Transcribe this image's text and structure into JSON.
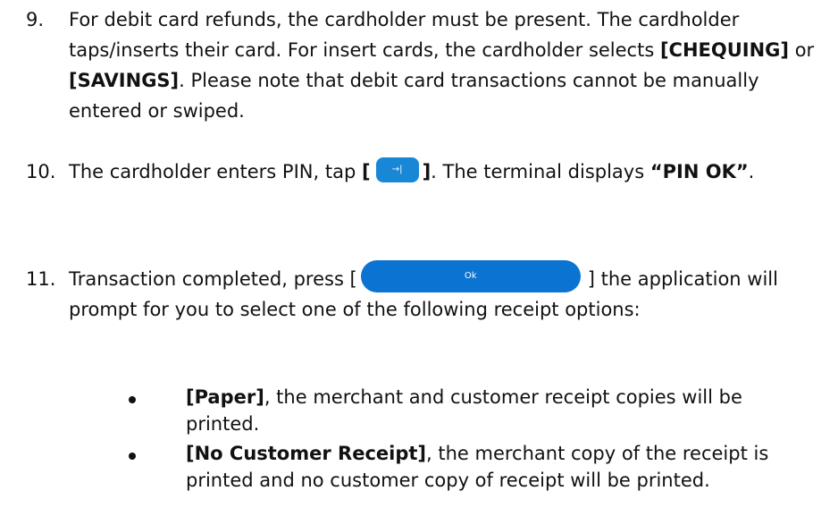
{
  "steps": [
    {
      "number": "9.",
      "t1": "For debit card refunds, the cardholder must be present. The cardholder taps/inserts their card. For insert cards, the cardholder selects ",
      "b1": "[CHEQUING]",
      "t2": " or ",
      "b2": "[SAVINGS]",
      "t3": ". Please note that debit card transactions cannot be manually entered or swiped."
    },
    {
      "number": "10.",
      "t1": "The cardholder enters PIN, tap ",
      "bracket_open": "[",
      "button_icon": "→|",
      "bracket_close": "]",
      "t2": ".  The terminal displays ",
      "b1": "“PIN OK”",
      "t3": "."
    },
    {
      "number": "11.",
      "t1": "Transaction completed, press [",
      "ok_label": "Ok",
      "t2": "]  the application will prompt for you to select one of the following receipt options:"
    }
  ],
  "receipt_options": [
    {
      "label": "[Paper]",
      "description": ", the merchant and customer receipt copies will be printed."
    },
    {
      "label": "[No Customer Receipt]",
      "description": ", the merchant copy of the receipt is printed and no customer copy of receipt will be printed."
    }
  ],
  "colors": {
    "arrow_button": "#1787d6",
    "ok_button": "#0b73d1"
  },
  "icons": {
    "enter_key": "arrow-right-to-bar-icon",
    "bullet": "bullet-dot-icon"
  }
}
